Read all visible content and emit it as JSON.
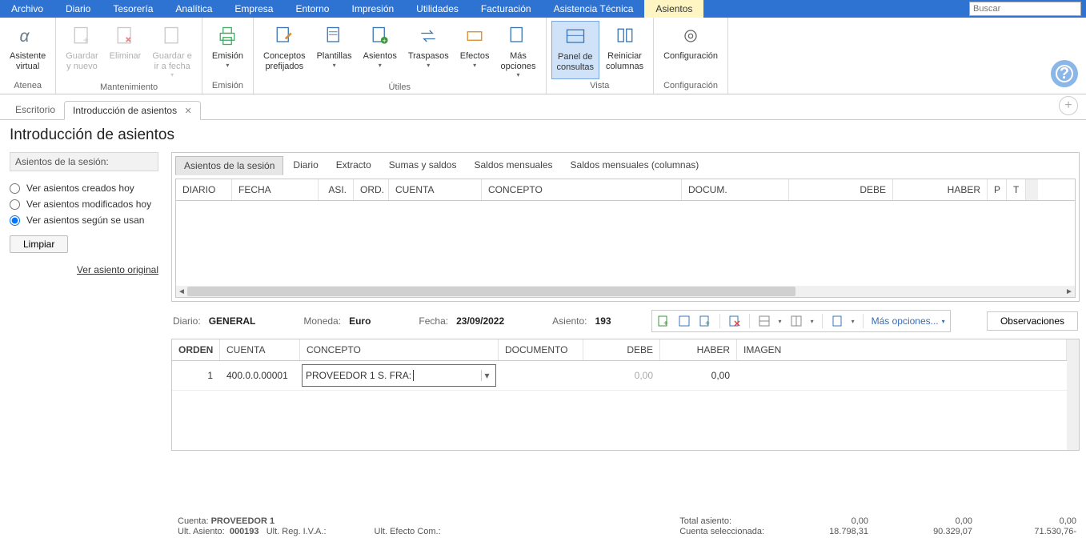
{
  "menu": {
    "items": [
      "Archivo",
      "Diario",
      "Tesorería",
      "Analítica",
      "Empresa",
      "Entorno",
      "Impresión",
      "Utilidades",
      "Facturación",
      "Asistencia Técnica",
      "Asientos"
    ],
    "search_placeholder": "Buscar"
  },
  "ribbon": {
    "groups": {
      "atenea": {
        "label": "Atenea",
        "asistente": "Asistente\nvirtual"
      },
      "mantenimiento": {
        "label": "Mantenimiento",
        "guardar_nuevo": "Guardar\ny nuevo",
        "eliminar": "Eliminar",
        "guardar_ir": "Guardar e\nir a fecha"
      },
      "emision": {
        "label": "Emisión",
        "emision": "Emisión"
      },
      "utiles": {
        "label": "Útiles",
        "conceptos": "Conceptos\nprefijados",
        "plantillas": "Plantillas",
        "asientos": "Asientos",
        "traspasos": "Traspasos",
        "efectos": "Efectos",
        "mas": "Más\nopciones"
      },
      "vista": {
        "label": "Vista",
        "panel": "Panel de\nconsultas",
        "reiniciar": "Reiniciar\ncolumnas"
      },
      "config": {
        "label": "Configuración",
        "config": "Configuración"
      }
    }
  },
  "doc_tabs": {
    "escritorio": "Escritorio",
    "intro": "Introducción de asientos"
  },
  "page_title": "Introducción de asientos",
  "sidebar": {
    "header": "Asientos de la sesión:",
    "r1": "Ver asientos creados hoy",
    "r2": "Ver asientos modificados hoy",
    "r3": "Ver asientos según se usan",
    "limpiar": "Limpiar",
    "ver_original": "Ver asiento original"
  },
  "innertabs": [
    "Asientos de la sesión",
    "Diario",
    "Extracto",
    "Sumas y saldos",
    "Saldos mensuales",
    "Saldos mensuales (columnas)"
  ],
  "grid1_cols": {
    "diario": "DIARIO",
    "fecha": "FECHA",
    "asi": "ASI.",
    "ord": "ORD.",
    "cuenta": "CUENTA",
    "concepto": "CONCEPTO",
    "docum": "DOCUM.",
    "debe": "DEBE",
    "haber": "HABER",
    "p": "P",
    "t": "T"
  },
  "mid": {
    "diario_l": "Diario:",
    "diario_v": "GENERAL",
    "moneda_l": "Moneda:",
    "moneda_v": "Euro",
    "fecha_l": "Fecha:",
    "fecha_v": "23/09/2022",
    "asiento_l": "Asiento:",
    "asiento_v": "193",
    "masop": "Más opciones...",
    "observ": "Observaciones"
  },
  "grid2_cols": {
    "orden": "ORDEN",
    "cuenta": "CUENTA",
    "concepto": "CONCEPTO",
    "documento": "DOCUMENTO",
    "debe": "DEBE",
    "haber": "HABER",
    "imagen": "IMAGEN"
  },
  "grid2_row": {
    "orden": "1",
    "cuenta": "400.0.0.00001",
    "concepto": "PROVEEDOR 1 S. FRA: ",
    "debe": "0,00",
    "haber": "0,00"
  },
  "footer": {
    "cuenta_l": "Cuenta:",
    "cuenta_v": "PROVEEDOR 1",
    "ultasi_l": "Ult. Asiento:",
    "ultasi_v": "000193",
    "ultreg_l": "Ult. Reg. I.V.A.:",
    "ultefecto_l": "Ult. Efecto Com.:",
    "total_l": "Total asiento:",
    "sel_l": "Cuenta seleccionada:",
    "t1": "0,00",
    "t2": "0,00",
    "t3": "0,00",
    "s1": "18.798,31",
    "s2": "90.329,07",
    "s3": "71.530,76-"
  }
}
